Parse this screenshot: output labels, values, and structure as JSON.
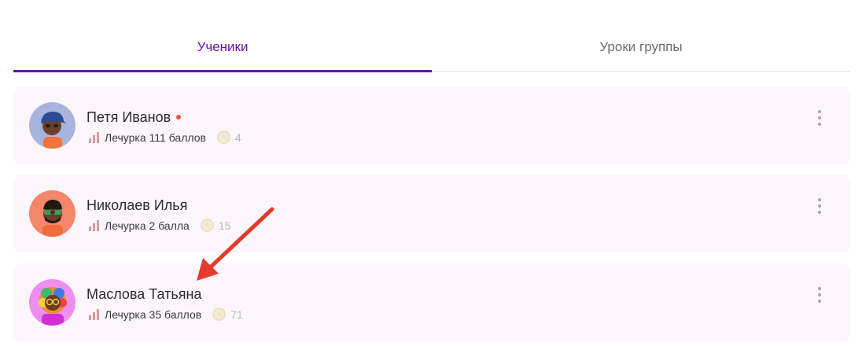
{
  "tabs": [
    {
      "label": "Ученики",
      "active": true
    },
    {
      "label": "Уроки группы",
      "active": false
    }
  ],
  "accent_color": "#6b12a3",
  "students": [
    {
      "name": "Петя Иванов",
      "online": true,
      "rank": "Лечурка 111 баллов",
      "coins": "4",
      "avatar": "boy-cap-avatar"
    },
    {
      "name": "Николаев Илья",
      "online": false,
      "rank": "Лечурка 2 балла",
      "coins": "15",
      "avatar": "man-sunglasses-avatar"
    },
    {
      "name": "Маслова Татьяна",
      "online": false,
      "rank": "Лечурка 35 баллов",
      "coins": "71",
      "avatar": "girl-rainbow-hair-avatar"
    }
  ]
}
